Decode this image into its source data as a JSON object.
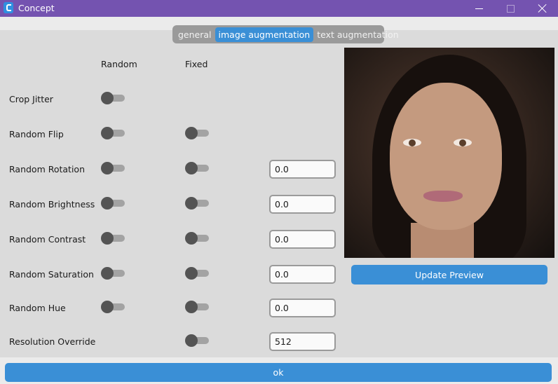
{
  "window": {
    "title": "Concept"
  },
  "tabs": [
    {
      "label": "general",
      "active": false
    },
    {
      "label": "image augmentation",
      "active": true
    },
    {
      "label": "text augmentation",
      "active": false
    }
  ],
  "columns": {
    "random": "Random",
    "fixed": "Fixed"
  },
  "rows": [
    {
      "label": "Crop Jitter",
      "random": false,
      "fixed": null,
      "value": null
    },
    {
      "label": "Random Flip",
      "random": false,
      "fixed": false,
      "value": null
    },
    {
      "label": "Random Rotation",
      "random": false,
      "fixed": false,
      "value": "0.0"
    },
    {
      "label": "Random Brightness",
      "random": false,
      "fixed": false,
      "value": "0.0"
    },
    {
      "label": "Random Contrast",
      "random": false,
      "fixed": false,
      "value": "0.0"
    },
    {
      "label": "Random Saturation",
      "random": false,
      "fixed": false,
      "value": "0.0"
    },
    {
      "label": "Random Hue",
      "random": false,
      "fixed": false,
      "value": "0.0"
    },
    {
      "label": "Resolution Override",
      "random": null,
      "fixed": false,
      "value": "512"
    }
  ],
  "preview": {
    "button_label": "Update Preview"
  },
  "footer": {
    "ok_label": "ok"
  },
  "colors": {
    "titlebar": "#7453b0",
    "accent": "#3a8fd6"
  }
}
